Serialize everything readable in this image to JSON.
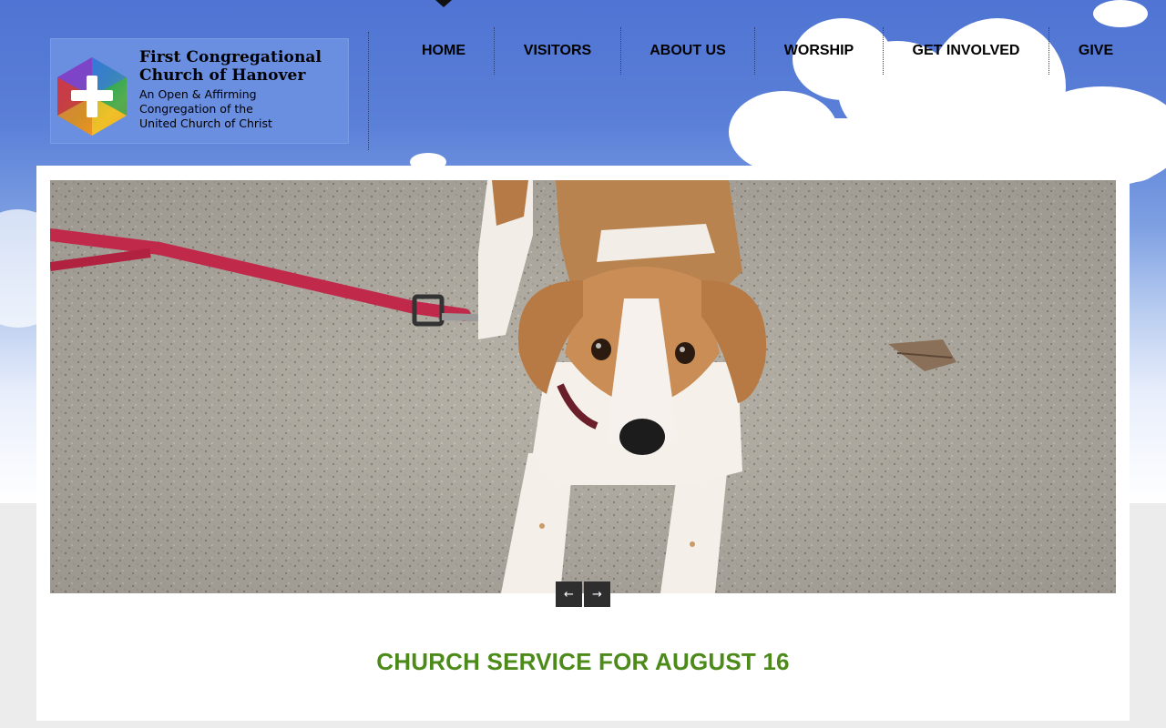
{
  "header": {
    "logo": {
      "title_line1": "First Congregational",
      "title_line2": "Church of Hanover",
      "subtitle_line1": "An Open & Affirming",
      "subtitle_line2": "Congregation of the",
      "subtitle_line3": "United Church of Christ"
    },
    "nav": {
      "items": [
        {
          "label": "HOME",
          "active": true
        },
        {
          "label": "VISITORS"
        },
        {
          "label": "ABOUT US"
        },
        {
          "label": "WORSHIP"
        },
        {
          "label": "GET INVOLVED"
        },
        {
          "label": "GIVE"
        }
      ]
    }
  },
  "slider": {
    "image_alt": "Beagle dog on a red leash standing on sandy ground",
    "prev_label": "←",
    "next_label": "→"
  },
  "post": {
    "title": "CHURCH SERVICE FOR AUGUST 16"
  },
  "colors": {
    "title_green": "#4c8a19",
    "nav_text": "#000000",
    "sky_blue": "#5b80d8"
  }
}
